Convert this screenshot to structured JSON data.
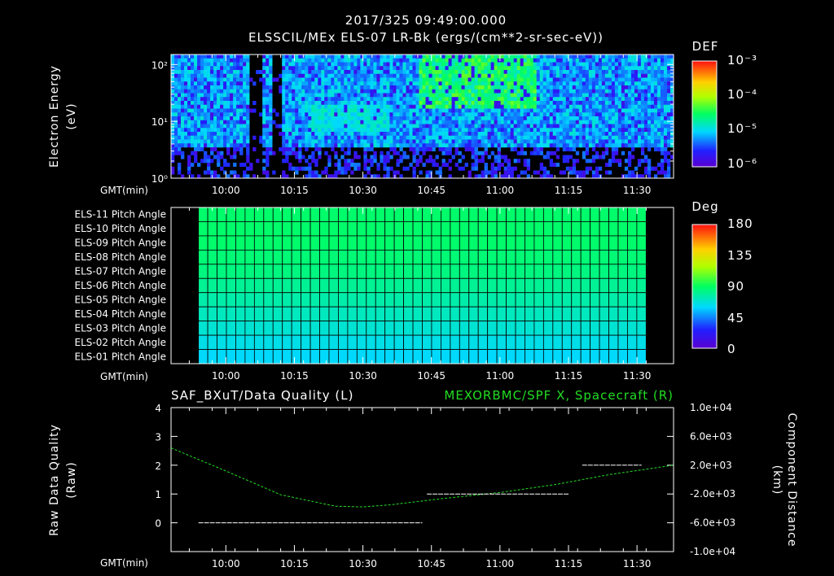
{
  "header": {
    "timestamp": "2017/325 09:49:00.000",
    "title": "ELSSCIL/MEx ELS-07 LR-Bk  (ergs/(cm**2-sr-sec-eV))"
  },
  "time_axis": {
    "label": "GMT(min)",
    "ticks": [
      "10:00",
      "10:15",
      "10:30",
      "10:45",
      "11:00",
      "11:15",
      "11:30"
    ],
    "tick_minutes": [
      600,
      615,
      630,
      645,
      660,
      675,
      690
    ],
    "range_minutes": [
      588,
      698
    ]
  },
  "colors": {
    "background": "#000000",
    "axes": "#ffffff",
    "right_series": "#22dd22"
  },
  "chart_data": [
    {
      "type": "heatmap",
      "name": "spectrogram",
      "ylabel_line1": "Electron Energy",
      "ylabel_line2": "(eV)",
      "yscale": "log",
      "ylim": [
        1,
        150
      ],
      "y_ticks": [
        "10²",
        "10¹",
        "10⁰"
      ],
      "colorbar": {
        "title": "DEF",
        "scale": "log",
        "range": [
          1e-06,
          0.001
        ],
        "ticks": [
          "10⁻³",
          "10⁻⁴",
          "10⁻⁵",
          "10⁻⁶"
        ]
      },
      "data_gaps_minutes": [
        [
          605,
          608
        ],
        [
          610,
          612
        ]
      ]
    },
    {
      "type": "heatmap",
      "name": "pitch-angle",
      "rows": [
        "ELS-11 Pitch Angle",
        "ELS-10 Pitch Angle",
        "ELS-09 Pitch Angle",
        "ELS-08 Pitch Angle",
        "ELS-07 Pitch Angle",
        "ELS-06 Pitch Angle",
        "ELS-05 Pitch Angle",
        "ELS-04 Pitch Angle",
        "ELS-03 Pitch Angle",
        "ELS-02 Pitch Angle",
        "ELS-01 Pitch Angle"
      ],
      "row_values_deg": [
        88,
        88,
        88,
        86,
        84,
        80,
        76,
        72,
        68,
        64,
        60
      ],
      "time_range_minutes": [
        594,
        692
      ],
      "colorbar": {
        "title": "Deg",
        "range": [
          0,
          180
        ],
        "ticks": [
          "180",
          "135",
          "90",
          "45",
          "0"
        ]
      }
    },
    {
      "type": "line",
      "name": "data-quality",
      "left_title": "SAF_BXuT/Data Quality (L)",
      "right_title": "MEXORBMC/SPF X, Spacecraft (R)",
      "left_ylabel_line1": "Raw Data Quality",
      "left_ylabel_line2": "(Raw)",
      "left_ylim": [
        -1,
        4
      ],
      "left_ticks": [
        "4",
        "3",
        "2",
        "1",
        "0"
      ],
      "right_ylabel_line1": "Component Distance",
      "right_ylabel_line2": "(km)",
      "right_ylim": [
        -10000,
        10000
      ],
      "right_ticks": [
        "1.0e+04",
        "6.0e+03",
        "2.0e+03",
        "-2.0e+03",
        "-6.0e+03",
        "-1.0e+04"
      ],
      "quality_segments": [
        {
          "x": [
            594,
            643
          ],
          "y": 0
        },
        {
          "x": [
            644,
            675
          ],
          "y": 1
        },
        {
          "x": [
            678,
            691
          ],
          "y": 2
        }
      ],
      "distance_series": {
        "x": [
          588,
          600,
          612,
          624,
          630,
          636,
          648,
          660,
          672,
          684,
          698
        ],
        "y": [
          4400,
          1200,
          -2100,
          -3700,
          -3800,
          -3500,
          -2600,
          -1800,
          -700,
          700,
          2000
        ]
      }
    }
  ]
}
